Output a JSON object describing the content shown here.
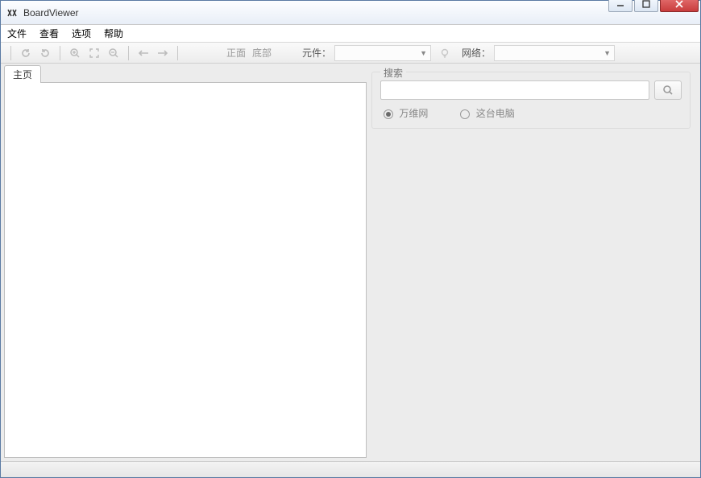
{
  "window": {
    "title": "BoardViewer"
  },
  "menu": {
    "file": "文件",
    "view": "查看",
    "options": "选项",
    "help": "帮助"
  },
  "toolbar": {
    "front": "正面",
    "bottom": "底部",
    "component_label": "元件：",
    "network_label": "网络："
  },
  "tabs": {
    "home": "主页"
  },
  "search": {
    "legend": "搜索",
    "radio_web": "万维网",
    "radio_local": "这台电脑"
  }
}
